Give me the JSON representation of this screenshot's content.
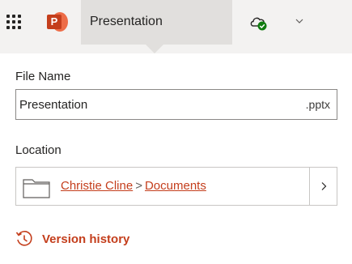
{
  "header": {
    "document_title": "Presentation",
    "app_icon_letter": "P",
    "icons": {
      "launcher": "app-launcher-icon",
      "app": "powerpoint-logo-icon",
      "sync": "cloud-saved-icon",
      "expand": "chevron-down-icon"
    }
  },
  "file_panel": {
    "file_name_label": "File Name",
    "file_name_value": "Presentation",
    "file_extension": ".pptx",
    "location_label": "Location",
    "location_path": [
      {
        "label": "Christie Cline"
      },
      {
        "label": "Documents"
      }
    ],
    "location_separator": ">",
    "version_history_label": "Version history"
  },
  "colors": {
    "accent": "#c43e1c",
    "header_bg": "#f3f2f1",
    "title_button_bg": "#e1dfdd",
    "sync_ok": "#107c10"
  }
}
